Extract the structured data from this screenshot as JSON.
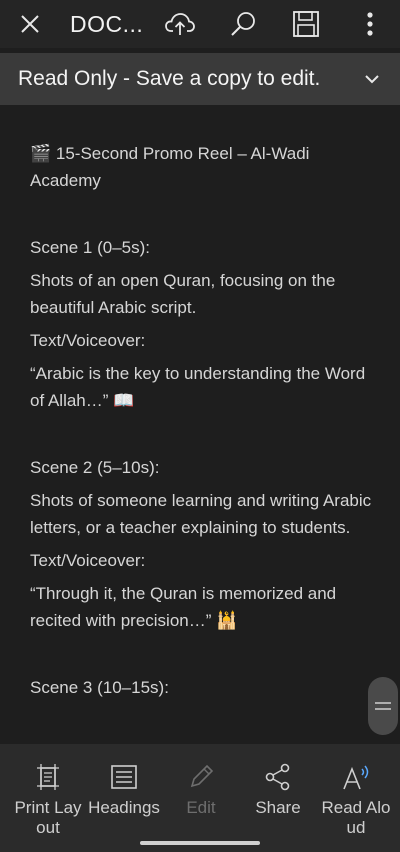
{
  "toolbar": {
    "title": "DOC...C",
    "close_icon": "close-icon",
    "upload_icon": "cloud-upload-icon",
    "search_icon": "search-icon",
    "save_icon": "save-icon",
    "more_icon": "more-vertical-icon"
  },
  "banner": {
    "text": "Read Only - Save a copy to edit.",
    "chevron_icon": "chevron-down-icon"
  },
  "document": {
    "heading_line1": "🎬 15-Second Promo Reel – Al-Wadi",
    "heading_line2": "Academy",
    "scene1_title": "Scene 1 (0–5s):",
    "scene1_desc": "Shots of an open Quran, focusing on the beautiful Arabic script.",
    "scene1_vo_label": "Text/Voiceover:",
    "scene1_vo": "“Arabic is the key to understanding the Word of Allah…” 📖",
    "scene2_title": "Scene 2 (5–10s):",
    "scene2_desc": "Shots of someone learning and writing Arabic letters, or a teacher explaining to students.",
    "scene2_vo_label": "Text/Voiceover:",
    "scene2_vo": "“Through it, the Quran is memorized and recited with precision…” 🕌",
    "scene3_title": "Scene 3 (10–15s):"
  },
  "bottom_bar": {
    "print_layout": "Print Layout",
    "headings": "Headings",
    "edit": "Edit",
    "share": "Share",
    "read_aloud": "Read Aloud"
  }
}
